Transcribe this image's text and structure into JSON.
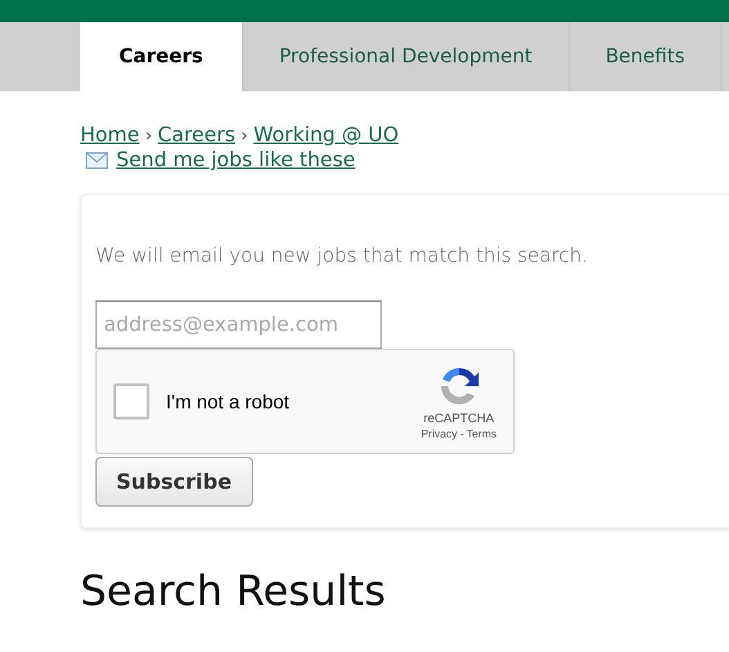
{
  "tabs": [
    {
      "label": "Careers",
      "selected": true
    },
    {
      "label": "Professional Development",
      "selected": false
    },
    {
      "label": "Benefits",
      "selected": false
    }
  ],
  "breadcrumb": {
    "items": [
      "Home",
      "Careers",
      "Working @ UO"
    ],
    "separator": "›"
  },
  "subscribe_link": "Send me jobs like these",
  "subscribe_panel": {
    "intro": "We will email you new jobs that match this search.",
    "email": {
      "placeholder": "address@example.com"
    },
    "recaptcha": {
      "label": "I'm not a robot",
      "checked": false,
      "brand": "reCAPTCHA",
      "privacy": "Privacy",
      "separator": "-",
      "terms": "Terms"
    },
    "button": "Subscribe"
  },
  "heading": "Search Results"
}
